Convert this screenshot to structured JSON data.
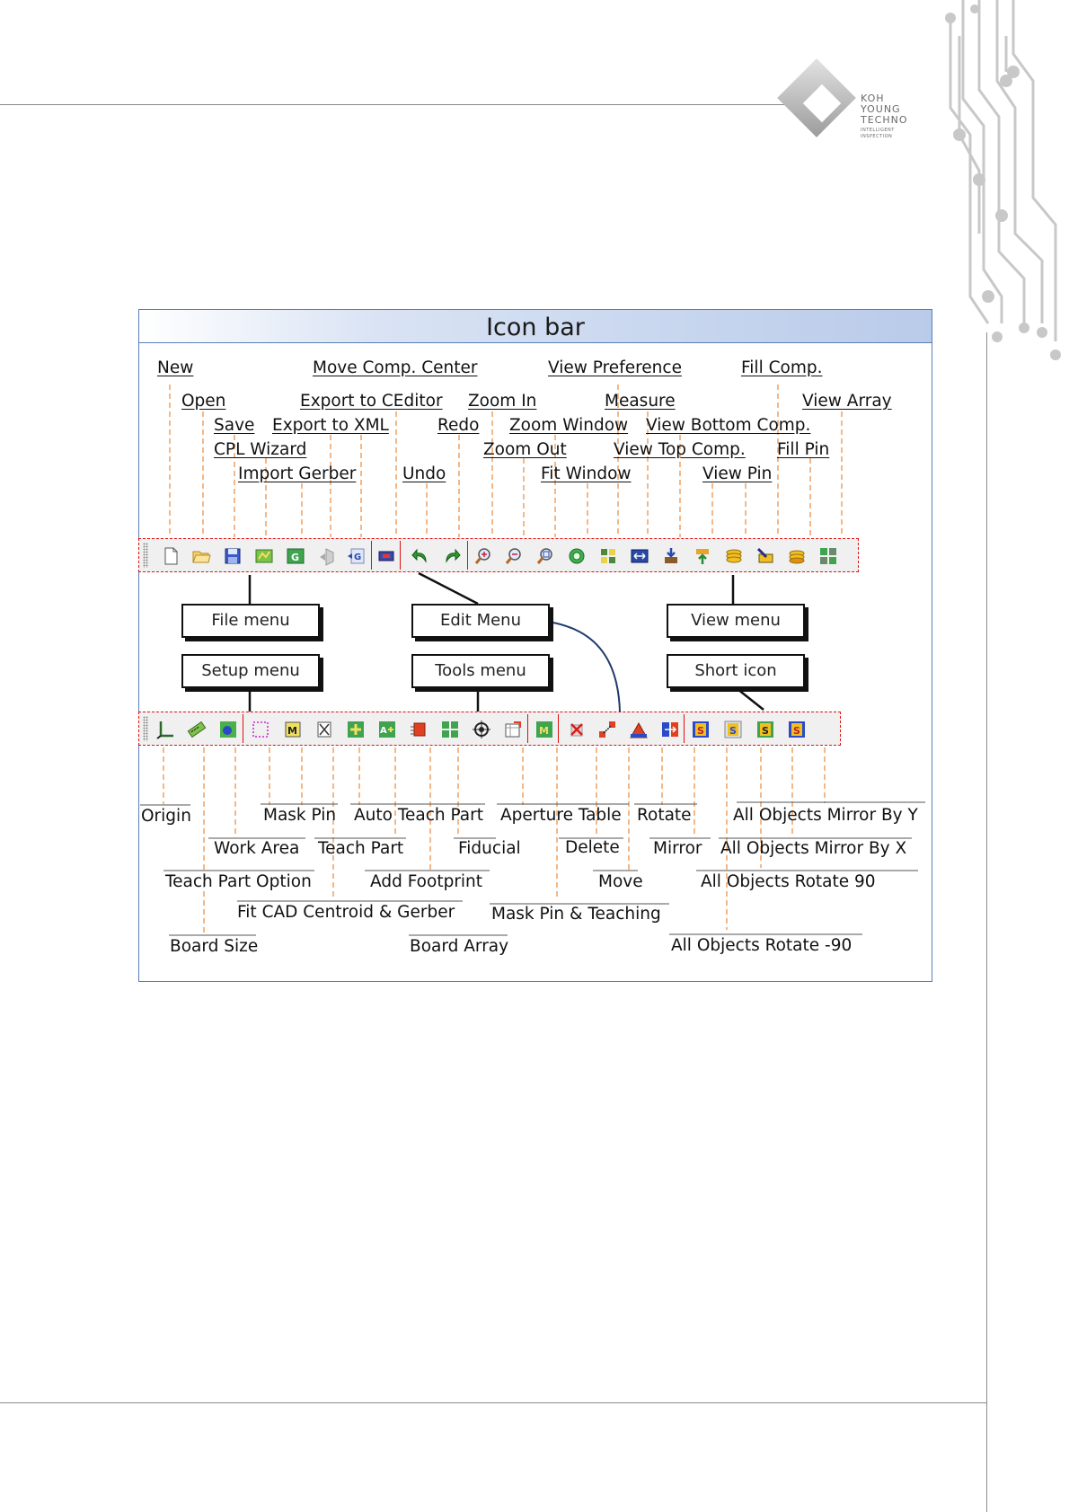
{
  "logo": {
    "line1": "KOH",
    "line2": "YOUNG",
    "line3": "TECHNO",
    "line4": "INTELLIGENT",
    "line5": "INSPECTION"
  },
  "figure": {
    "title": "Icon bar",
    "menus": {
      "file": "File menu",
      "edit": "Edit Menu",
      "view": "View menu",
      "setup": "Setup menu",
      "tools": "Tools menu",
      "short": "Short icon"
    },
    "top_labels": {
      "new": "New",
      "move_comp_center": "Move Comp. Center",
      "view_preference": "View Preference",
      "fill_comp": "Fill Comp.",
      "open": "Open",
      "export_to_ceditor": "Export to CEditor",
      "zoom_in": "Zoom In",
      "measure": "Measure",
      "view_array": "View Array",
      "save": "Save",
      "export_to_xml": "Export to XML",
      "redo": "Redo",
      "zoom_window": "Zoom Window",
      "view_bottom_comp": "View Bottom Comp.",
      "cpl_wizard": "CPL Wizard",
      "zoom_out": "Zoom Out",
      "view_top_comp": "View Top Comp.",
      "fill_pin": "Fill Pin",
      "import_gerber": "Import Gerber",
      "undo": "Undo",
      "fit_window": "Fit Window",
      "view_pin": "View Pin"
    },
    "bottom_labels": {
      "origin": "Origin",
      "mask_pin": "Mask Pin",
      "auto_teach_part": "Auto Teach Part",
      "aperture_table": "Aperture Table",
      "rotate": "Rotate",
      "all_mirror_y": "All Objects Mirror  By Y",
      "work_area": "Work Area",
      "teach_part": "Teach Part",
      "fiducial": "Fiducial",
      "delete": "Delete",
      "mirror": "Mirror",
      "all_mirror_x": "All Objects Mirror  By X",
      "teach_part_option": "Teach Part Option",
      "add_footprint": "Add Footprint",
      "move": "Move",
      "all_rotate_90": "All Objects Rotate 90",
      "fit_cad": "Fit CAD  Centroid & Gerber",
      "mask_pin_teaching": "Mask Pin & Teaching",
      "board_size": "Board Size",
      "board_array": "Board Array",
      "all_rotate_neg90": "All Objects Rotate -90"
    }
  },
  "colors": {
    "dashed_leader": "#f0a060",
    "toolbar_border": "#e01010",
    "figure_border": "#5a7fb8",
    "connector_navy": "#203a6a"
  }
}
